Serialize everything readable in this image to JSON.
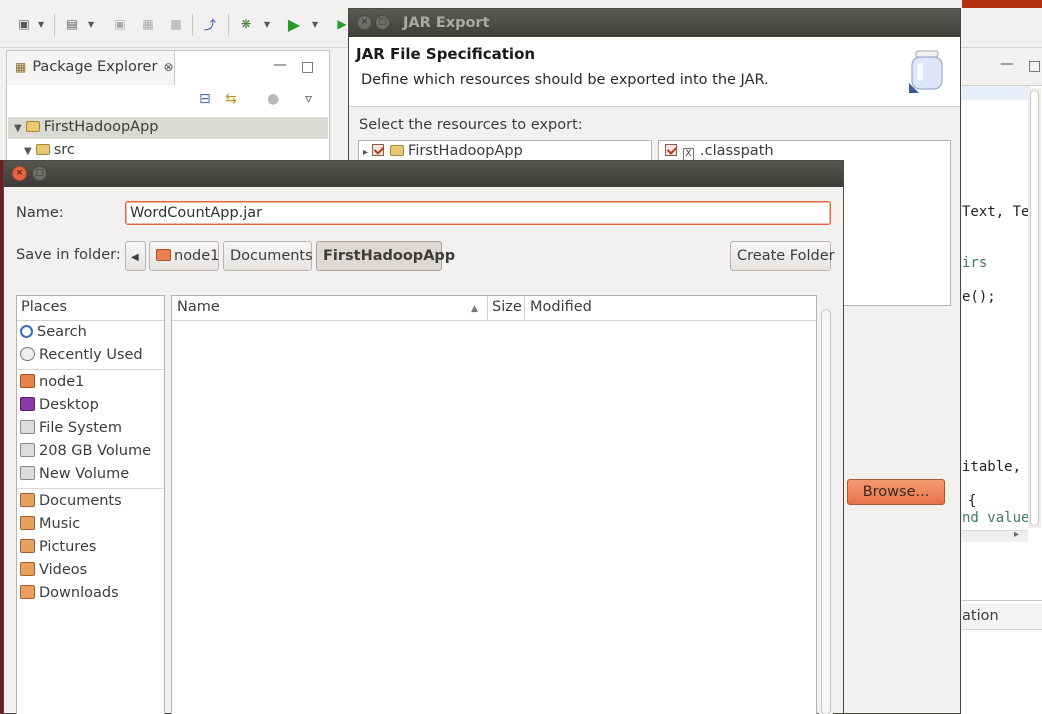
{
  "eclipse": {
    "package_explorer": {
      "tab_label": "Package Explorer",
      "tree": [
        {
          "label": "FirstHadoopApp"
        },
        {
          "label": "src"
        }
      ]
    },
    "editor": {
      "code_fragments": [
        "Text, Te",
        "irs",
        "e();",
        "itable,",
        "{",
        "nd value"
      ]
    },
    "bottom_tab_fragment": "ation"
  },
  "jar_export": {
    "window_title": "JAR Export",
    "header_title": "JAR File Specification",
    "header_description": "Define which resources should be exported into the JAR.",
    "select_label": "Select the resources to export:",
    "left_tree": [
      {
        "label": "FirstHadoopApp",
        "checked": true
      }
    ],
    "right_tree": [
      {
        "label": ".classpath",
        "checked": true
      }
    ],
    "browse_label": "Browse..."
  },
  "save_dialog": {
    "name_label": "Name:",
    "name_value": "WordCountApp.jar",
    "save_in_label": "Save in folder:",
    "path": [
      "node1",
      "Documents",
      "FirstHadoopApp"
    ],
    "create_folder_label": "Create Folder",
    "places_header": "Places",
    "places": [
      {
        "label": "Search",
        "icon": "search-icon"
      },
      {
        "label": "Recently Used",
        "icon": "recent-icon"
      },
      {
        "label": "node1",
        "icon": "home-folder-icon"
      },
      {
        "label": "Desktop",
        "icon": "desktop-icon"
      },
      {
        "label": "File System",
        "icon": "drive-icon"
      },
      {
        "label": "208 GB Volume",
        "icon": "drive-icon"
      },
      {
        "label": "New Volume",
        "icon": "drive-icon"
      },
      {
        "label": "Documents",
        "icon": "documents-icon"
      },
      {
        "label": "Music",
        "icon": "music-icon"
      },
      {
        "label": "Pictures",
        "icon": "pictures-icon"
      },
      {
        "label": "Videos",
        "icon": "videos-icon"
      },
      {
        "label": "Downloads",
        "icon": "downloads-icon"
      }
    ],
    "columns": {
      "name": "Name",
      "size": "Size",
      "modified": "Modified"
    }
  }
}
